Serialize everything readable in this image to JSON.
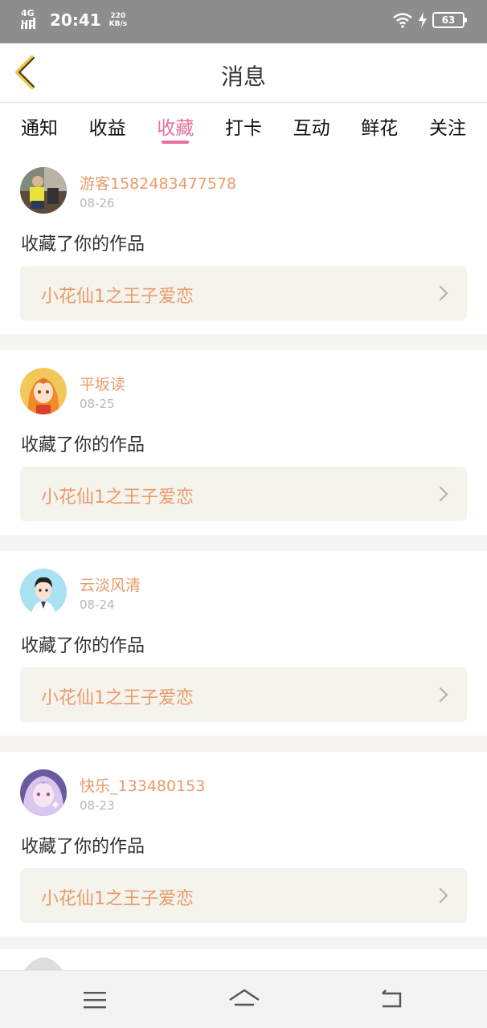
{
  "status_bar": {
    "network": "4G HD",
    "time": "20:41",
    "speed_value": "220",
    "speed_unit": "KB/s",
    "battery": "63"
  },
  "header": {
    "title": "消息",
    "back_icon": "chevron-left-icon",
    "accent_color": "#e8709f"
  },
  "tabs": [
    {
      "label": "通知",
      "active": false
    },
    {
      "label": "收益",
      "active": false
    },
    {
      "label": "收藏",
      "active": true
    },
    {
      "label": "打卡",
      "active": false
    },
    {
      "label": "互动",
      "active": false
    },
    {
      "label": "鲜花",
      "active": false
    },
    {
      "label": "关注",
      "active": false
    }
  ],
  "items": [
    {
      "username": "游客1582483477578",
      "date": "08-26",
      "action": "收藏了你的作品",
      "work": "小花仙1之王子爱恋"
    },
    {
      "username": "平坂读",
      "date": "08-25",
      "action": "收藏了你的作品",
      "work": "小花仙1之王子爱恋"
    },
    {
      "username": "云淡风清",
      "date": "08-24",
      "action": "收藏了你的作品",
      "work": "小花仙1之王子爱恋"
    },
    {
      "username": "快乐_133480153",
      "date": "08-23",
      "action": "收藏了你的作品",
      "work": "小花仙1之王子爱恋"
    }
  ],
  "nav": {
    "menu_icon": "menu-icon",
    "home_icon": "home-icon",
    "back_icon": "return-icon"
  }
}
